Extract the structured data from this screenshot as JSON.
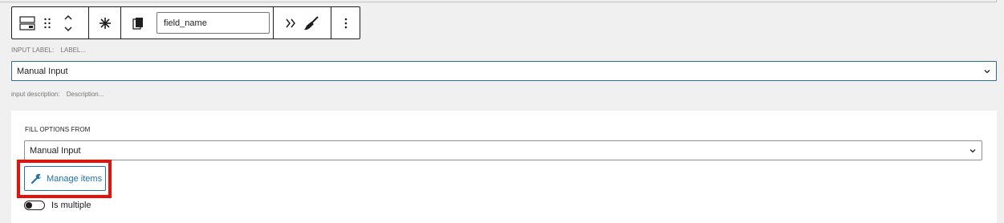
{
  "toolbar": {
    "field_name_value": "field_name",
    "icons": [
      "block-type-icon",
      "drag-handle-icon",
      "move-up-down-icon",
      "asterisk-icon",
      "copy-icon",
      "double-chevron-right-icon",
      "brush-icon",
      "more-options-icon"
    ]
  },
  "input_label": {
    "label": "INPUT LABEL:",
    "placeholder": "LABEL..."
  },
  "source_select": {
    "selected": "Manual Input"
  },
  "input_description": {
    "label": "input description:",
    "placeholder": "Description..."
  },
  "options_panel": {
    "title": "FILL OPTIONS FROM",
    "selected": "Manual Input",
    "manage_button": "Manage items",
    "toggle_label": "Is multiple"
  },
  "colors": {
    "accent": "#2271b1",
    "highlight": "#e8110a",
    "select_border": "#2c6f8f"
  }
}
